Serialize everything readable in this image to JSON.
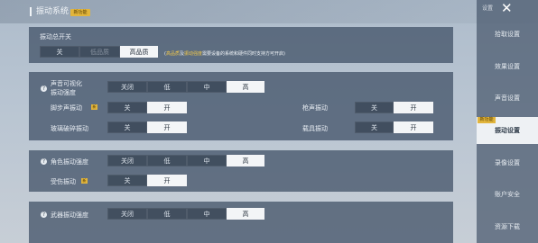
{
  "header": {
    "title": "振动系统",
    "badge": "新功能"
  },
  "sidebar": {
    "top_label": "设置",
    "close": "✕",
    "items": [
      {
        "label": "拾取设置"
      },
      {
        "label": "效果设置"
      },
      {
        "label": "声音设置"
      },
      {
        "label": "振动设置",
        "active": true,
        "badge": "新功能"
      },
      {
        "label": "录像设置"
      },
      {
        "label": "账户安全"
      },
      {
        "label": "资源下载"
      }
    ]
  },
  "master": {
    "label": "振动总开关",
    "options": [
      "关",
      "低品质",
      "高品质"
    ],
    "selected": "高品质",
    "note_prefix": "(",
    "note_hl1": "高品质",
    "note_mid": "及",
    "note_hl2": "振动强度",
    "note_rest": "需要设备的系统和硬件同时支持方可开启)"
  },
  "sound": {
    "label": "声音可视化\n振动强度",
    "levels": [
      "关闭",
      "低",
      "中",
      "高"
    ],
    "selected": "高",
    "footstep": {
      "label": "脚步声振动",
      "tag": "新",
      "off": "关",
      "on": "开"
    },
    "gunshot": {
      "label": "枪声振动",
      "off": "关",
      "on": "开"
    },
    "glass": {
      "label": "玻璃破碎振动",
      "off": "关",
      "on": "开"
    },
    "vehicle": {
      "label": "载具振动",
      "off": "关",
      "on": "开"
    }
  },
  "character": {
    "label": "角色振动强度",
    "levels": [
      "关闭",
      "低",
      "中",
      "高"
    ],
    "selected": "高",
    "hit": {
      "label": "受伤振动",
      "tag": "新",
      "off": "关",
      "on": "开"
    }
  },
  "weapon": {
    "label": "武器振动强度",
    "levels": [
      "关闭",
      "低",
      "中",
      "高"
    ],
    "selected": "高"
  },
  "help_icon": "?"
}
